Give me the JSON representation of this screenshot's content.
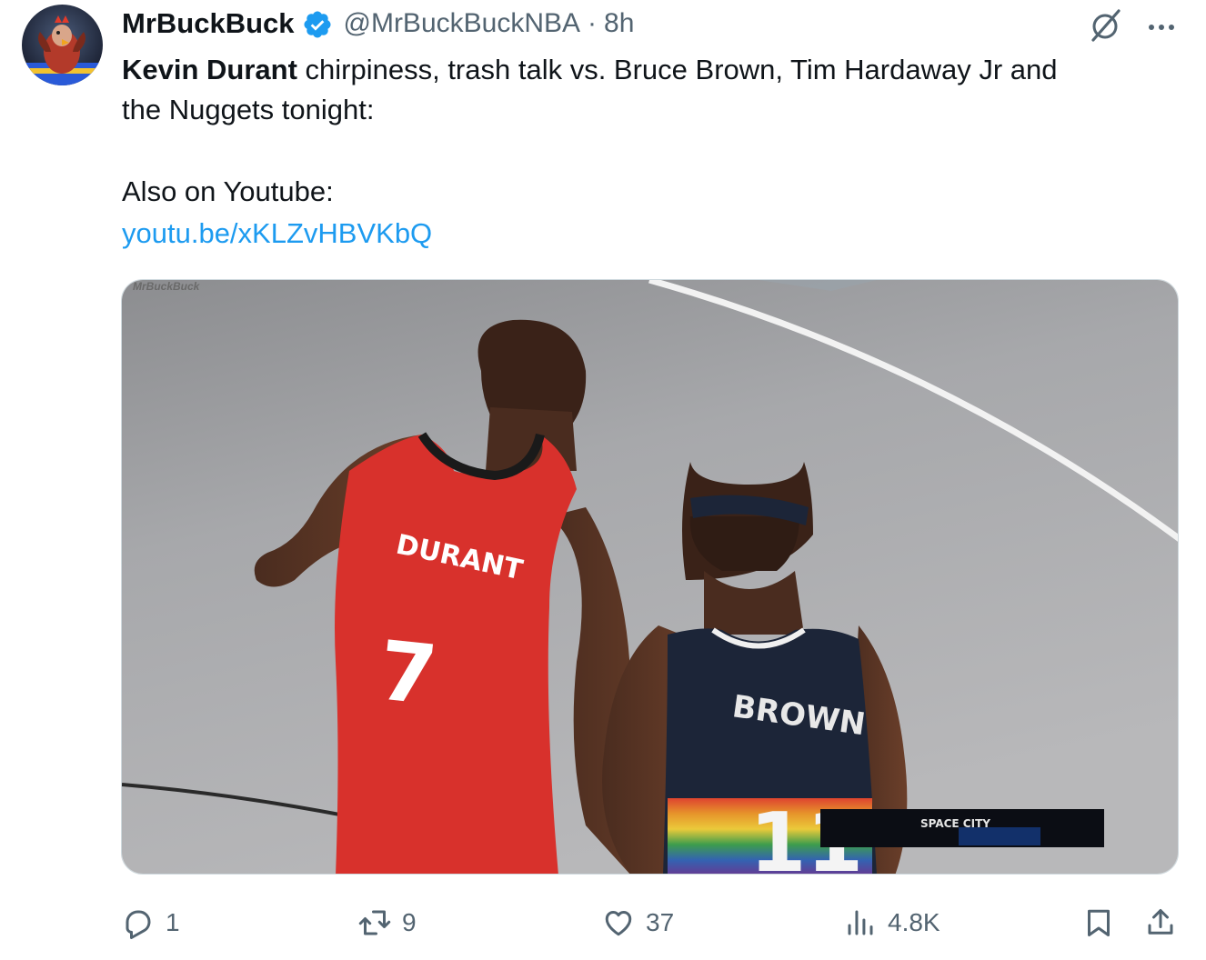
{
  "author": {
    "display_name": "MrBuckBuck",
    "handle": "@MrBuckBuckNBA",
    "separator": "·",
    "time": "8h"
  },
  "tweet": {
    "bold_lead": "Kevin Durant",
    "text_line1": " chirpiness, trash talk vs. Bruce Brown, Tim Hardaway Jr and",
    "text_line2": "the Nuggets tonight:",
    "also_label": "Also on Youtube:",
    "link": "youtu.be/xKLZvHBVKbQ"
  },
  "media": {
    "watermark": "MrBuckBuck",
    "jersey_left_name": "DURANT",
    "jersey_left_number": "7",
    "jersey_right_name": "BROWN",
    "jersey_right_number": "11",
    "broadcast_tag": "SPACE CITY"
  },
  "actions": {
    "replies": "1",
    "reposts": "9",
    "likes": "37",
    "views": "4.8K"
  },
  "colors": {
    "accent": "#1d9bf0",
    "muted": "#536471",
    "rockets_red": "#d8312c",
    "nuggets_navy": "#1c2538"
  },
  "icons": [
    "verified-badge-icon",
    "grok-icon",
    "more-icon",
    "reply-icon",
    "repost-icon",
    "like-icon",
    "views-icon",
    "bookmark-icon",
    "share-icon"
  ]
}
